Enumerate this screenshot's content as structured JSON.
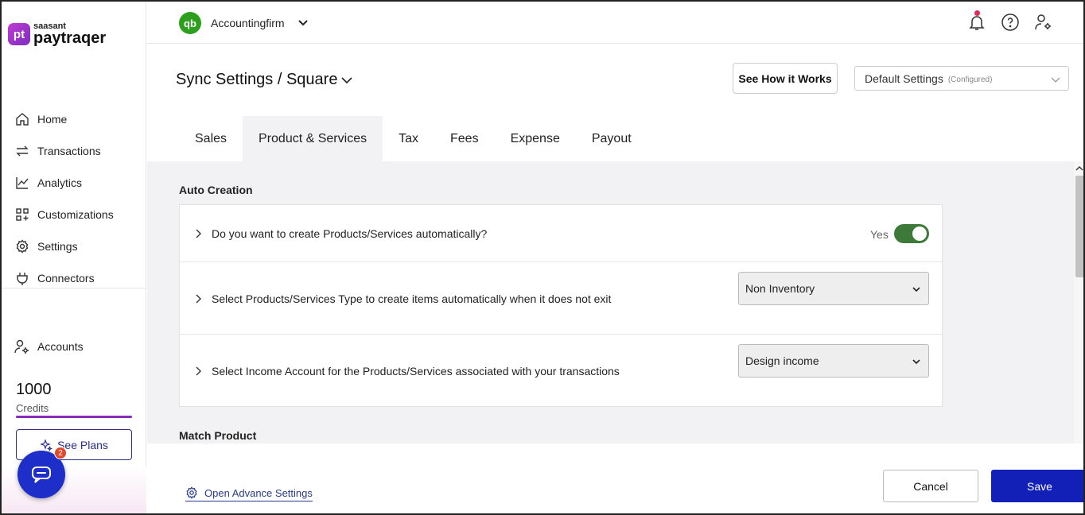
{
  "brand": {
    "small": "saasant",
    "big": "paytraqer",
    "mark": "pt"
  },
  "nav": [
    {
      "label": "Home",
      "icon": "home-icon"
    },
    {
      "label": "Transactions",
      "icon": "transfer-icon"
    },
    {
      "label": "Analytics",
      "icon": "chart-icon"
    },
    {
      "label": "Customizations",
      "icon": "grid-icon"
    },
    {
      "label": "Settings",
      "icon": "gear-icon"
    },
    {
      "label": "Connectors",
      "icon": "plug-icon"
    }
  ],
  "accounts_label": "Accounts",
  "credits": {
    "value": "1000",
    "label": "Credits",
    "level_fraction": 1.0
  },
  "see_plans": "See Plans",
  "chat_badge": "2",
  "header": {
    "company": "Accountingfirm",
    "company_icon_text": "qb"
  },
  "page": {
    "title": "Sync Settings / Square",
    "how_it_works": "See How it Works",
    "settings_select": {
      "value": "Default Settings",
      "status": "(Configured)"
    }
  },
  "tabs": [
    {
      "label": "Sales",
      "active": false
    },
    {
      "label": "Product & Services",
      "active": true
    },
    {
      "label": "Tax",
      "active": false
    },
    {
      "label": "Fees",
      "active": false
    },
    {
      "label": "Expense",
      "active": false
    },
    {
      "label": "Payout",
      "active": false
    }
  ],
  "auto_creation": {
    "title": "Auto Creation",
    "rows": [
      {
        "text": "Do you want to create Products/Services automatically?",
        "toggle_label": "Yes",
        "toggle_on": true
      },
      {
        "text": "Select Products/Services Type to create items automatically when it does not exit",
        "value": "Non Inventory"
      },
      {
        "text": "Select Income Account for the Products/Services associated with your transactions",
        "value": "Design income"
      }
    ]
  },
  "match_product_title": "Match Product",
  "footer": {
    "advance": "Open Advance Settings",
    "cancel": "Cancel",
    "save": "Save"
  },
  "colors": {
    "accent": "#1320b8",
    "toggle": "#3d7a3a",
    "brand": "#8a2bb8",
    "qb": "#2ca01c"
  }
}
